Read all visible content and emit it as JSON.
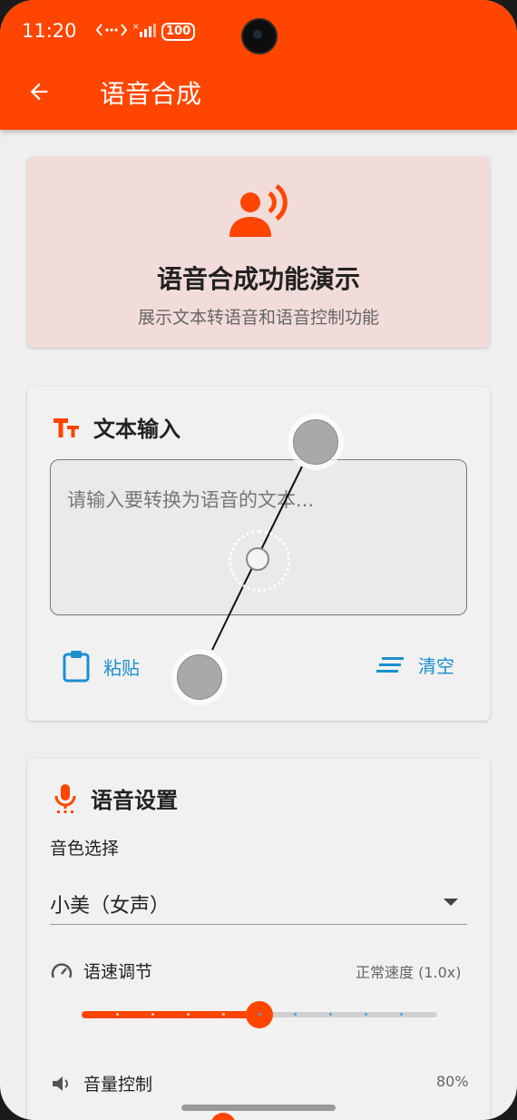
{
  "status_bar": {
    "time": "11:20",
    "battery": "100"
  },
  "app_bar": {
    "title": "语音合成"
  },
  "hero": {
    "title": "语音合成功能演示",
    "subtitle": "展示文本转语音和语音控制功能"
  },
  "text_input": {
    "section_title": "文本输入",
    "placeholder": "请输入要转换为语音的文本...",
    "paste_label": "粘贴",
    "clear_label": "清空"
  },
  "voice_settings": {
    "section_title": "语音设置",
    "timbre_label": "音色选择",
    "timbre_value": "小美（女声）",
    "speed_label": "语速调节",
    "speed_value": "正常速度 (1.0x)",
    "speed_slider_fraction": 0.5,
    "speed_slider_divisions": 10,
    "volume_label": "音量控制",
    "volume_value": "80%"
  },
  "colors": {
    "accent": "#ff4500",
    "link": "#1a8fd0",
    "hero_bg": "#f2dcda"
  },
  "icons": {
    "back": "arrow-left-icon",
    "hero": "record-voice-icon",
    "text": "text-fields-icon",
    "paste": "clipboard-icon",
    "clear": "clear-all-icon",
    "voice": "mic-icon",
    "speed": "speed-gauge-icon",
    "volume": "volume-icon"
  }
}
